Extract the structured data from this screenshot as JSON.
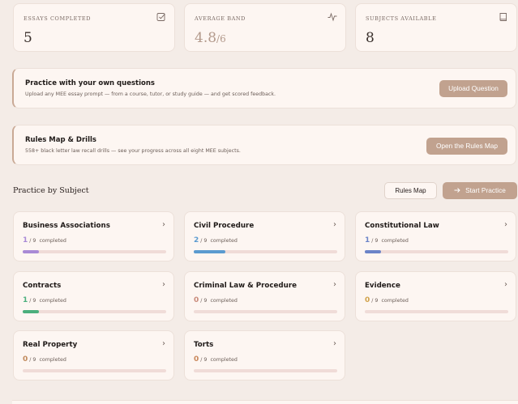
{
  "stats": [
    {
      "label": "Essays Completed",
      "value": "5",
      "suffix": "",
      "icon": "checkbox-icon"
    },
    {
      "label": "Average Band",
      "value": "4.8",
      "suffix": "/6",
      "icon": "activity-icon"
    },
    {
      "label": "Subjects Available",
      "value": "8",
      "suffix": "",
      "icon": "book-icon"
    }
  ],
  "banners": {
    "practice": {
      "title": "Practice with your own questions",
      "subtitle": "Upload any MEE essay prompt — from a course, tutor, or study guide — and get scored feedback.",
      "button": "Upload Question"
    },
    "rules": {
      "title": "Rules Map & Drills",
      "subtitle": "558+ black letter law recall drills — see your progress across all eight MEE subjects.",
      "button": "Open the Rules Map"
    }
  },
  "section": {
    "title": "Practice by Subject",
    "rules_map_button": "Rules Map",
    "start_practice_button": "Start Practice",
    "start_icon": "arrow-right-icon"
  },
  "subjects": [
    {
      "name": "Business Associations",
      "completed": "1",
      "total": "/ 9",
      "suffix": "completed",
      "progress": 0.111,
      "color": "#a98ad6"
    },
    {
      "name": "Civil Procedure",
      "completed": "2",
      "total": "/ 9",
      "suffix": "completed",
      "progress": 0.222,
      "color": "#5b9bd0"
    },
    {
      "name": "Constitutional Law",
      "completed": "1",
      "total": "/ 9",
      "suffix": "completed",
      "progress": 0.111,
      "color": "#6b84c8"
    },
    {
      "name": "Contracts",
      "completed": "1",
      "total": "/ 9",
      "suffix": "completed",
      "progress": 0.111,
      "color": "#4caf7d"
    },
    {
      "name": "Criminal Law & Procedure",
      "completed": "0",
      "total": "/ 9",
      "suffix": "completed",
      "progress": 0,
      "color": "#c98a7a"
    },
    {
      "name": "Evidence",
      "completed": "0",
      "total": "/ 9",
      "suffix": "completed",
      "progress": 0,
      "color": "#d1a24a"
    },
    {
      "name": "Real Property",
      "completed": "0",
      "total": "/ 9",
      "suffix": "completed",
      "progress": 0,
      "color": "#c18a5c"
    },
    {
      "name": "Torts",
      "completed": "0",
      "total": "/ 9",
      "suffix": "completed",
      "progress": 0,
      "color": "#c9875a"
    }
  ],
  "colors": {
    "accent": "#c1a28f",
    "card_bg": "#fdf6f2",
    "page_bg": "#f4ece7",
    "track": "#f0dcd8"
  }
}
